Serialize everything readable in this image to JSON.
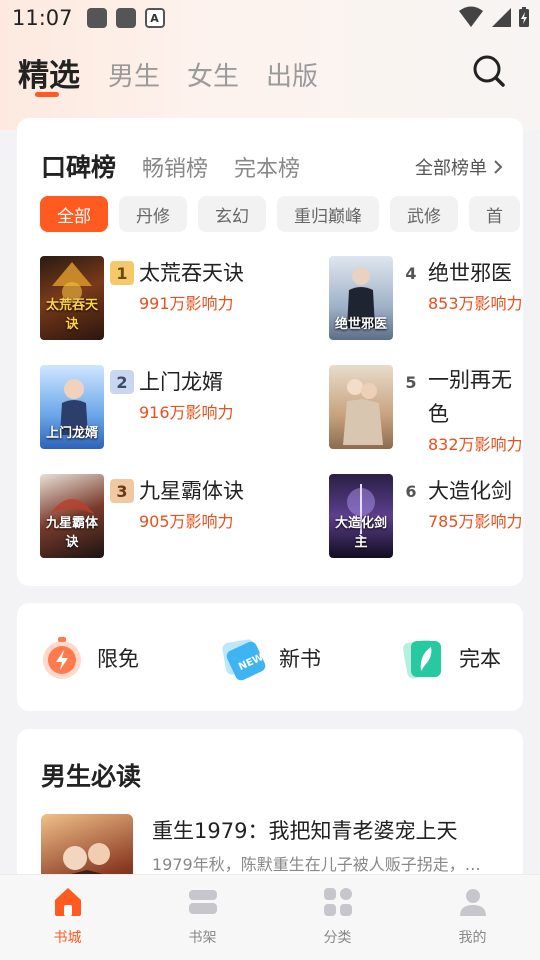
{
  "status_bar": {
    "time": "11:07",
    "notification_letter": "A"
  },
  "channels": {
    "tabs": [
      "精选",
      "男生",
      "女生",
      "出版"
    ],
    "active_index": 0
  },
  "ranking": {
    "tabs": [
      "口碑榜",
      "畅销榜",
      "完本榜"
    ],
    "all_link": "全部榜单",
    "filters": [
      "全部",
      "丹修",
      "玄幻",
      "重归巅峰",
      "武修",
      "首"
    ],
    "books": [
      {
        "rank": "1",
        "title": "太荒吞天诀",
        "heat": "991万影响力",
        "cover_text": "太荒吞天诀"
      },
      {
        "rank": "2",
        "title": "上门龙婿",
        "heat": "916万影响力",
        "cover_text": "上门龙婿"
      },
      {
        "rank": "3",
        "title": "九星霸体诀",
        "heat": "905万影响力",
        "cover_text": "九星霸体诀"
      },
      {
        "rank": "4",
        "title": "绝世邪医",
        "heat": "853万影响力",
        "cover_text": "绝世邪医"
      },
      {
        "rank": "5",
        "title": "一别再无色",
        "heat": "832万影响力",
        "cover_text": ""
      },
      {
        "rank": "6",
        "title": "大造化剑",
        "heat": "785万影响力",
        "cover_text": "大造化剑主"
      }
    ]
  },
  "quick_entries": [
    {
      "label": "限免",
      "icon": "stopwatch-lightning-icon"
    },
    {
      "label": "新书",
      "icon": "new-tag-icon"
    },
    {
      "label": "完本",
      "icon": "feather-book-icon"
    }
  ],
  "recommend": {
    "section_title": "男生必读",
    "book_title": "重生1979：我把知青老婆宠上天",
    "book_desc": "1979年秋，陈默重生在儿子被人贩子拐走，…"
  },
  "bottom_nav": {
    "items": [
      {
        "label": "书城",
        "icon": "home-icon"
      },
      {
        "label": "书架",
        "icon": "bookshelf-icon"
      },
      {
        "label": "分类",
        "icon": "category-grid-icon"
      },
      {
        "label": "我的",
        "icon": "profile-icon"
      }
    ],
    "active_index": 0
  },
  "colors": {
    "accent": "#ff5a1f",
    "heat_text": "#e8501d",
    "gold_badge": "#f3c969",
    "silver_badge": "#c9d6ef",
    "bronze_badge": "#f0c9a3"
  }
}
